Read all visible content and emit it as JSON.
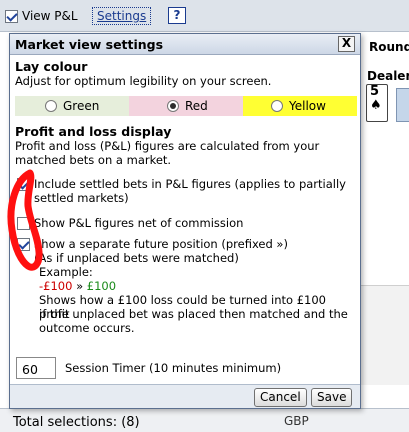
{
  "topbar": {
    "view_pl_label": "View P&L",
    "view_pl_checked": true,
    "settings_link": "Settings",
    "help_label": "?"
  },
  "background": {
    "round_label": "Round",
    "dealer_label": "Dealer",
    "dealer_card_rank": "5",
    "dealer_card_suit": "♠",
    "panel_fragment": "nts"
  },
  "bottombar": {
    "total_selections": "Total selections: (8)",
    "currency": "GBP"
  },
  "dialog": {
    "title": "Market view settings",
    "close_label": "X",
    "lay_colour": {
      "heading": "Lay colour",
      "description": "Adjust for optimum legibility on your screen.",
      "options": [
        {
          "label": "Green",
          "color": "#e6eedb",
          "selected": false
        },
        {
          "label": "Red",
          "color": "#f3d3de",
          "selected": true
        },
        {
          "label": "Yellow",
          "color": "#ffff33",
          "selected": false
        }
      ],
      "base_color": "#d4e5ef"
    },
    "pl_display": {
      "heading": "Profit and loss display",
      "description_line1": "Profit and loss (P&L) figures are calculated from your",
      "description_line2": "matched bets on a market.",
      "options": [
        {
          "line1": "Include settled bets in P&L figures (applies to partially",
          "line2": "settled markets)",
          "checked": true
        },
        {
          "line1": "Show P&L figures net of commission",
          "line2": "",
          "checked": false
        },
        {
          "line1": "Show a separate future position (prefixed »)",
          "line2": "(As if unplaced bets were matched)",
          "checked": true
        }
      ],
      "example_label": "Example:",
      "example_neg": "-£100",
      "example_arrow": " » ",
      "example_pos": "£100",
      "example_note_line1": "Shows how a £100 loss could be turned into £100 profit",
      "example_note_line2": "if the unplaced bet was placed then matched and the",
      "example_note_line3": "outcome occurs."
    },
    "session_timer": {
      "value": "60",
      "label": "Session Timer (10 minutes minimum)"
    },
    "cancel_label": "Cancel",
    "save_label": "Save"
  }
}
